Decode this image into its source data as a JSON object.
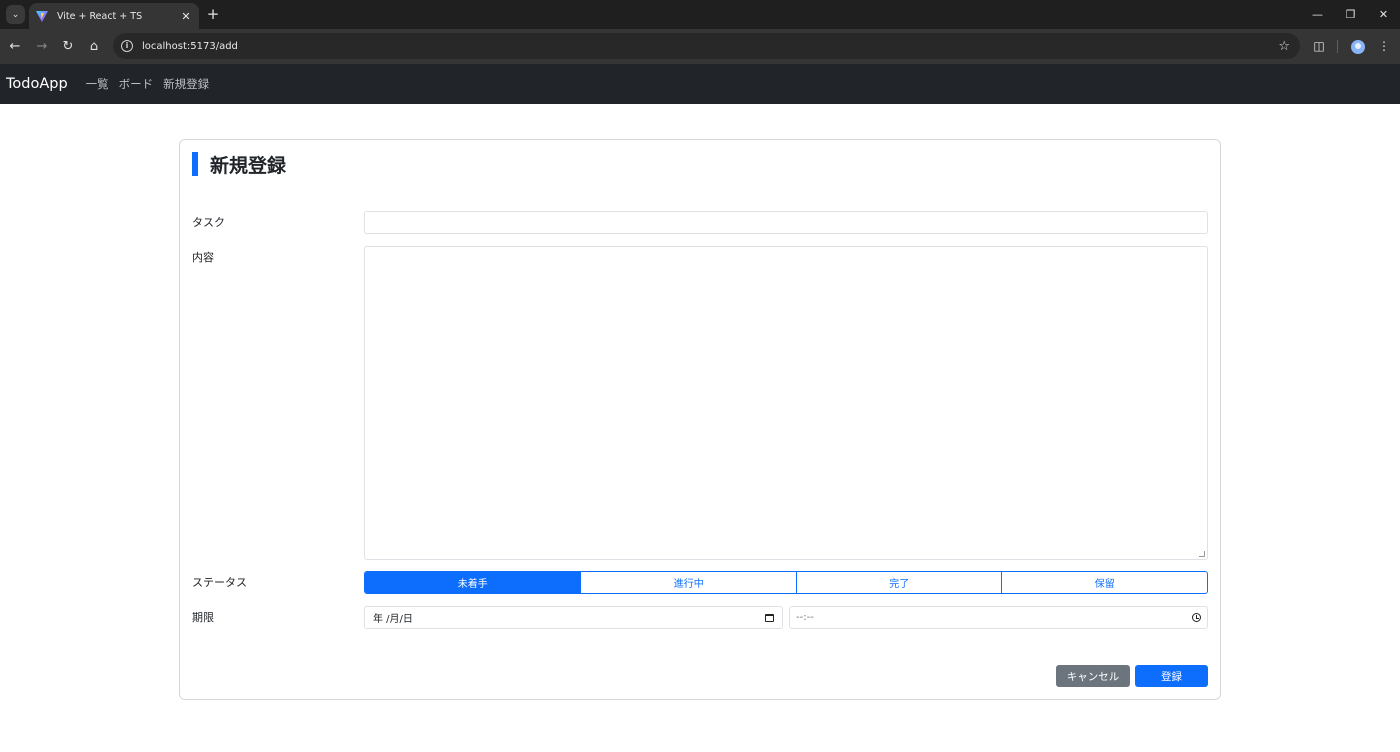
{
  "browser": {
    "tab_title": "Vite + React + TS",
    "url": "localhost:5173/add",
    "icons": [
      "tab-search-icon",
      "vite-favicon-icon",
      "close-icon",
      "plus-icon",
      "minimize-icon",
      "restore-icon",
      "window-close-icon",
      "back-icon",
      "forward-icon",
      "reload-icon",
      "home-icon",
      "info-icon",
      "star-icon",
      "extensions-icon",
      "profile-icon",
      "menu-icon"
    ]
  },
  "navbar": {
    "brand": "TodoApp",
    "links": [
      "一覧",
      "ボード",
      "新規登録"
    ]
  },
  "form": {
    "title": "新規登録",
    "task_label": "タスク",
    "task_value": "",
    "content_label": "内容",
    "content_value": "",
    "status_label": "ステータス",
    "status_options": [
      "未着手",
      "進行中",
      "完了",
      "保留"
    ],
    "status_selected": "未着手",
    "due_label": "期限",
    "date_placeholder": "年 /月/日",
    "time_placeholder": "--:--",
    "cancel_label": "キャンセル",
    "submit_label": "登録"
  },
  "colors": {
    "primary": "#0d6efd",
    "secondary": "#6c757d",
    "navbar_bg": "#212529"
  }
}
